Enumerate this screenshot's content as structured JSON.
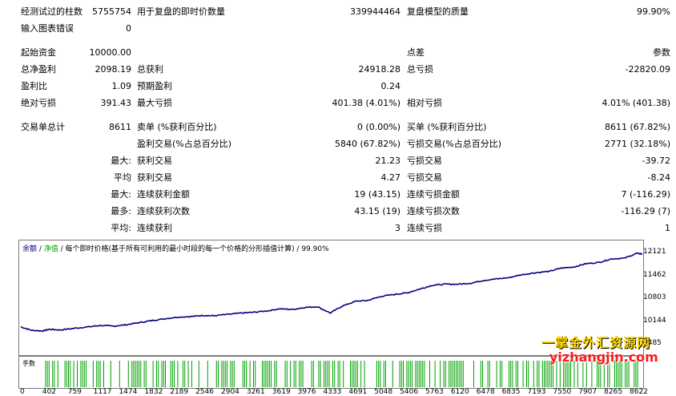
{
  "report": {
    "bars_tested_label": "经测试过的柱数",
    "bars_tested": "5755754",
    "ticks_label": "用于复盘的即时价数量",
    "ticks": "339944464",
    "quality_label": "复盘模型的质量",
    "quality": "99.90%",
    "mismatch_label": "输入图表错误",
    "mismatch": "0",
    "initial_deposit_label": "起始资金",
    "initial_deposit": "10000.00",
    "spread_label": "点差",
    "spread": "参数",
    "net_profit_label": "总净盈利",
    "net_profit": "2098.19",
    "gross_profit_label": "总获利",
    "gross_profit": "24918.28",
    "gross_loss_label": "总亏损",
    "gross_loss": "-22820.09",
    "profit_factor_label": "盈利比",
    "profit_factor": "1.09",
    "expected_payoff_label": "预期盈利",
    "expected_payoff": "0.24",
    "abs_drawdown_label": "绝对亏损",
    "abs_drawdown": "391.43",
    "max_drawdown_label": "最大亏损",
    "max_drawdown": "401.38 (4.01%)",
    "rel_drawdown_label": "相对亏损",
    "rel_drawdown": "4.01% (401.38)",
    "total_trades_label": "交易单总计",
    "total_trades": "8611",
    "short_label": "卖单 (%获利百分比)",
    "short": "0 (0.00%)",
    "long_label": "买单 (%获利百分比)",
    "long": "8611 (67.82%)",
    "profit_trades_label": "盈利交易(%占总百分比)",
    "profit_trades": "5840 (67.82%)",
    "loss_trades_label": "亏损交易(%占总百分比)",
    "loss_trades": "2771 (32.18%)",
    "largest_prefix": "最大:",
    "largest_profit_label": "获利交易",
    "largest_profit": "21.23",
    "largest_loss_label": "亏损交易",
    "largest_loss": "-39.72",
    "average_prefix": "平均",
    "average_profit_label": "获利交易",
    "average_profit": "4.27",
    "average_loss_label": "亏损交易",
    "average_loss": "-8.24",
    "max_prefix": "最大:",
    "max_cons_wins_label": "连续获利金额",
    "max_cons_wins": "19 (43.15)",
    "max_cons_losses_label": "连续亏损金额",
    "max_cons_losses": "7 (-116.29)",
    "maximal_prefix": "最多:",
    "maximal_cons_profit_label": "连续获利次数",
    "maximal_cons_profit": "43.15 (19)",
    "maximal_cons_loss_label": "连续亏损次数",
    "maximal_cons_loss": "-116.29 (7)",
    "avg_cons_prefix": "平均:",
    "avg_cons_wins_label": "连续获利",
    "avg_cons_wins": "3",
    "avg_cons_losses_label": "连续亏损",
    "avg_cons_losses": "1"
  },
  "chart_legend": {
    "balance": "余额",
    "sep1": " / ",
    "equity": "净值",
    "rest": " / 每个即时价格(基于所有可利用的最小时段的每一个价格的分形插值计算) / 99.90%"
  },
  "volume_label": "手数",
  "watermark": {
    "line1": "一掌金外汇资源网",
    "line2": "yizhangjin.com"
  },
  "colors": {
    "balance_line": "#000080",
    "volume_bars": "#00a000",
    "axis": "#7a7a7a"
  },
  "chart_data": {
    "type": "line",
    "y_ticks": [
      "12121",
      "11462",
      "10803",
      "10144",
      "9485"
    ],
    "y_tick_values": [
      12121,
      11462,
      10803,
      10144,
      9485
    ],
    "x_ticks": [
      "0",
      "402",
      "759",
      "1117",
      "1474",
      "1832",
      "2189",
      "2546",
      "2904",
      "3261",
      "3619",
      "3976",
      "4333",
      "4691",
      "5048",
      "5406",
      "5763",
      "6120",
      "6478",
      "6835",
      "7193",
      "7550",
      "7907",
      "8265",
      "8622"
    ],
    "x_tick_values": [
      0,
      402,
      759,
      1117,
      1474,
      1832,
      2189,
      2546,
      2904,
      3261,
      3619,
      3976,
      4333,
      4691,
      5048,
      5406,
      5763,
      6120,
      6478,
      6835,
      7193,
      7550,
      7907,
      8265,
      8622
    ],
    "xlim": [
      0,
      8622
    ],
    "ylim": [
      9485,
      12121
    ],
    "series": [
      {
        "name": "余额",
        "x": [
          0,
          150,
          300,
          402,
          550,
          759,
          950,
          1117,
          1300,
          1474,
          1650,
          1832,
          2000,
          2189,
          2400,
          2546,
          2700,
          2904,
          3100,
          3261,
          3450,
          3619,
          3800,
          3976,
          4150,
          4333,
          4500,
          4691,
          4850,
          5048,
          5250,
          5406,
          5600,
          5763,
          5950,
          6120,
          6300,
          6478,
          6650,
          6835,
          7000,
          7193,
          7400,
          7550,
          7750,
          7907,
          8100,
          8265,
          8450,
          8622,
          8700
        ],
        "y": [
          10000,
          9900,
          9880,
          9930,
          9910,
          9960,
          10000,
          10040,
          10020,
          10060,
          10120,
          10180,
          10230,
          10280,
          10300,
          10330,
          10320,
          10360,
          10400,
          10420,
          10460,
          10520,
          10500,
          10560,
          10580,
          10400,
          10600,
          10740,
          10760,
          10880,
          10940,
          10980,
          11100,
          11200,
          11230,
          11230,
          11260,
          11340,
          11380,
          11420,
          11500,
          11560,
          11600,
          11690,
          11730,
          11820,
          11860,
          11960,
          11980,
          12121,
          12100
        ]
      }
    ]
  }
}
